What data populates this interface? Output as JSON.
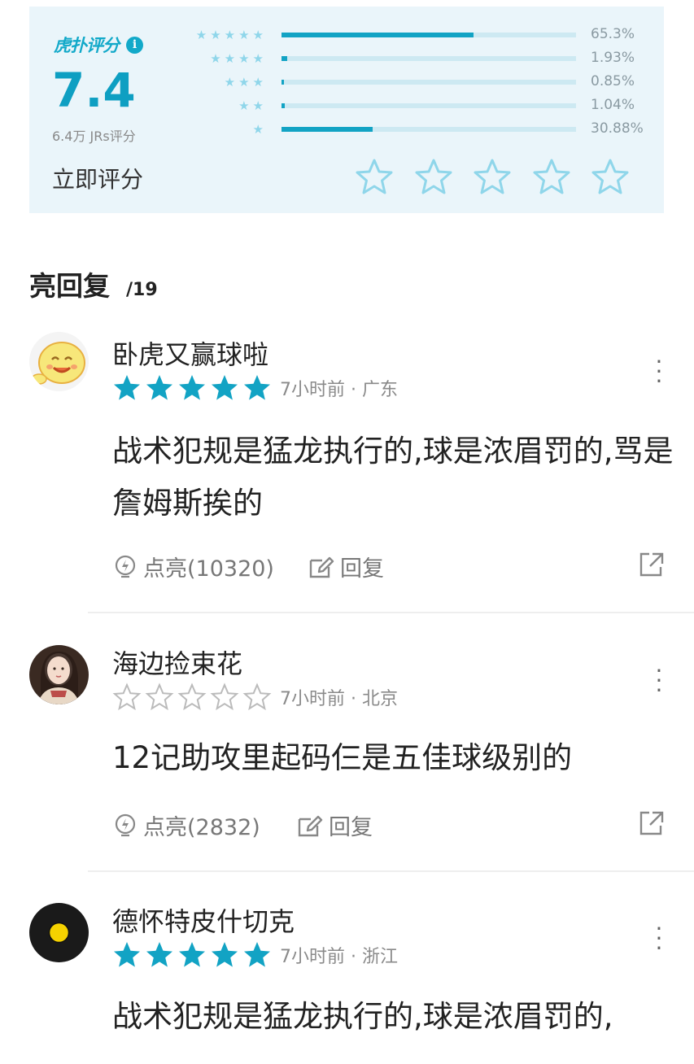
{
  "rating": {
    "brand": "虎扑评分",
    "score": "7.4",
    "count_label": "6.4万 JRs评分",
    "rate_now_label": "立即评分",
    "distribution": [
      {
        "stars": 5,
        "star_glyphs": "★★★★★",
        "percent_label": "65.3%",
        "fraction": 0.653
      },
      {
        "stars": 4,
        "star_glyphs": "★★★★",
        "percent_label": "1.93%",
        "fraction": 0.0193
      },
      {
        "stars": 3,
        "star_glyphs": "★★★",
        "percent_label": "0.85%",
        "fraction": 0.0085
      },
      {
        "stars": 2,
        "star_glyphs": "★★",
        "percent_label": "1.04%",
        "fraction": 0.0104
      },
      {
        "stars": 1,
        "star_glyphs": "★",
        "percent_label": "30.88%",
        "fraction": 0.3088
      }
    ],
    "accent_color": "#12a3c4"
  },
  "section": {
    "title": "亮回复",
    "count": "/19"
  },
  "comments": [
    {
      "username": "卧虎又赢球啦",
      "rating": 5,
      "meta": "7小时前 · 广东",
      "text": "战术犯规是猛龙执行的,球是浓眉罚的,骂是詹姆斯挨的",
      "like_label": "点亮(10320)",
      "reply_label": "回复",
      "avatar_icon": "cartoon-chick-icon"
    },
    {
      "username": "海边捡束花",
      "rating": 0,
      "meta": "7小时前 · 北京",
      "text": "12记助攻里起码仨是五佳球级别的",
      "like_label": "点亮(2832)",
      "reply_label": "回复",
      "avatar_icon": "user-photo-icon"
    },
    {
      "username": "德怀特皮什切克",
      "rating": 5,
      "meta": "7小时前 · 浙江",
      "text": "战术犯规是猛龙执行的,球是浓眉罚的,",
      "avatar_icon": "bvb-logo-icon"
    }
  ]
}
